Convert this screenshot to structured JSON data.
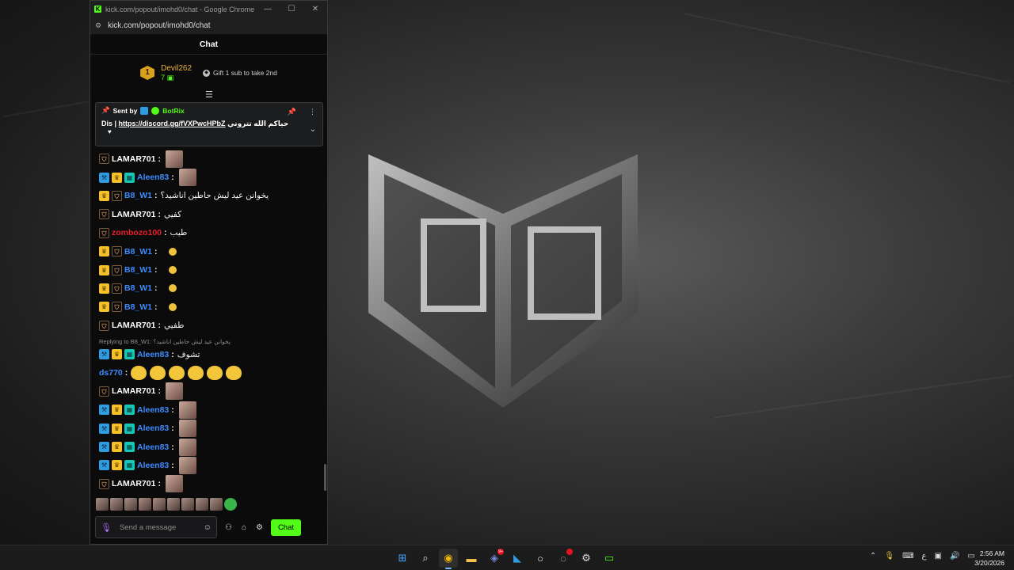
{
  "window": {
    "title": "kick.com/popout/imohd0/chat - Google Chrome",
    "url": "kick.com/popout/imohd0/chat",
    "controls": [
      "—",
      "☐",
      "✕"
    ]
  },
  "chat": {
    "header": "Chat",
    "leaderboard": {
      "rank": "1",
      "name": "Devil262",
      "count": "7",
      "gift_hint": "Gift 1 sub to take 2nd"
    },
    "pinned": {
      "sent_by_label": "Sent by",
      "sender": "BotRix",
      "message_prefix": "Dis |",
      "link": "https://discord.gg/fVXPwcHPbZ",
      "message_arabic": "حياكم الله تتروني"
    },
    "messages": [
      {
        "badges": [
          "og"
        ],
        "user": "LAMAR701",
        "color": "#ffffff",
        "text": "",
        "emote": true
      },
      {
        "badges": [
          "mod",
          "vip",
          "sub"
        ],
        "user": "Aleen83",
        "color": "#3d8bff",
        "text": "",
        "emote": true
      },
      {
        "badges": [
          "vip",
          "og"
        ],
        "user": "B8_W1",
        "color": "#3d8bff",
        "text": "يخوانن عيد ليش حاطين اناشيد؟",
        "emote": false
      },
      {
        "badges": [
          "og"
        ],
        "user": "LAMAR701",
        "color": "#ffffff",
        "text": "كفيي",
        "emote": false
      },
      {
        "badges": [
          "og"
        ],
        "user": "zombozo100",
        "color": "#e8202c",
        "text": "طيب",
        "emote": false
      },
      {
        "badges": [
          "vip",
          "og"
        ],
        "user": "B8_W1",
        "color": "#3d8bff",
        "text": "",
        "smile": true
      },
      {
        "badges": [
          "vip",
          "og"
        ],
        "user": "B8_W1",
        "color": "#3d8bff",
        "text": "",
        "smile": true
      },
      {
        "badges": [
          "vip",
          "og"
        ],
        "user": "B8_W1",
        "color": "#3d8bff",
        "text": "",
        "smile": true
      },
      {
        "badges": [
          "vip",
          "og"
        ],
        "user": "B8_W1",
        "color": "#3d8bff",
        "text": "",
        "smile": true
      },
      {
        "badges": [
          "og"
        ],
        "user": "LAMAR701",
        "color": "#ffffff",
        "text": "طفيي",
        "emote": false
      }
    ],
    "reply": {
      "label": "Replying to B8_W1: يخوانن عيد ليش حاطين اناشيد؟",
      "badges": [
        "mod",
        "vip",
        "sub"
      ],
      "user": "Aleen83",
      "color": "#3d8bff",
      "text": "تشوف"
    },
    "messages_after": [
      {
        "badges": [],
        "user": "ds770",
        "color": "#3d8bff",
        "text": "",
        "cats": 6
      },
      {
        "badges": [
          "og"
        ],
        "user": "LAMAR701",
        "color": "#ffffff",
        "text": "",
        "emote": true
      },
      {
        "badges": [
          "mod",
          "vip",
          "sub"
        ],
        "user": "Aleen83",
        "color": "#3d8bff",
        "text": "",
        "emote": true
      },
      {
        "badges": [
          "mod",
          "vip",
          "sub"
        ],
        "user": "Aleen83",
        "color": "#3d8bff",
        "text": "",
        "emote": true
      },
      {
        "badges": [
          "mod",
          "vip",
          "sub"
        ],
        "user": "Aleen83",
        "color": "#3d8bff",
        "text": "",
        "emote": true
      },
      {
        "badges": [
          "mod",
          "vip",
          "sub"
        ],
        "user": "Aleen83",
        "color": "#3d8bff",
        "text": "",
        "emote": true
      },
      {
        "badges": [
          "og"
        ],
        "user": "LAMAR701",
        "color": "#ffffff",
        "text": "",
        "emote": true
      }
    ],
    "input_placeholder": "Send a message",
    "send_label": "Chat"
  },
  "taskbar": {
    "apps": [
      "windows-start",
      "search",
      "chrome",
      "file-explorer",
      "discord",
      "vscode",
      "app-circle",
      "app-notify",
      "steam",
      "terminal"
    ],
    "discord_badge": "9+",
    "lang": "ع",
    "time": "2:56 AM",
    "date": "3/20/2026"
  },
  "colors": {
    "kick_green": "#53fc18",
    "mod_blue": "#3d8bff",
    "vip_gold": "#f5c028"
  }
}
